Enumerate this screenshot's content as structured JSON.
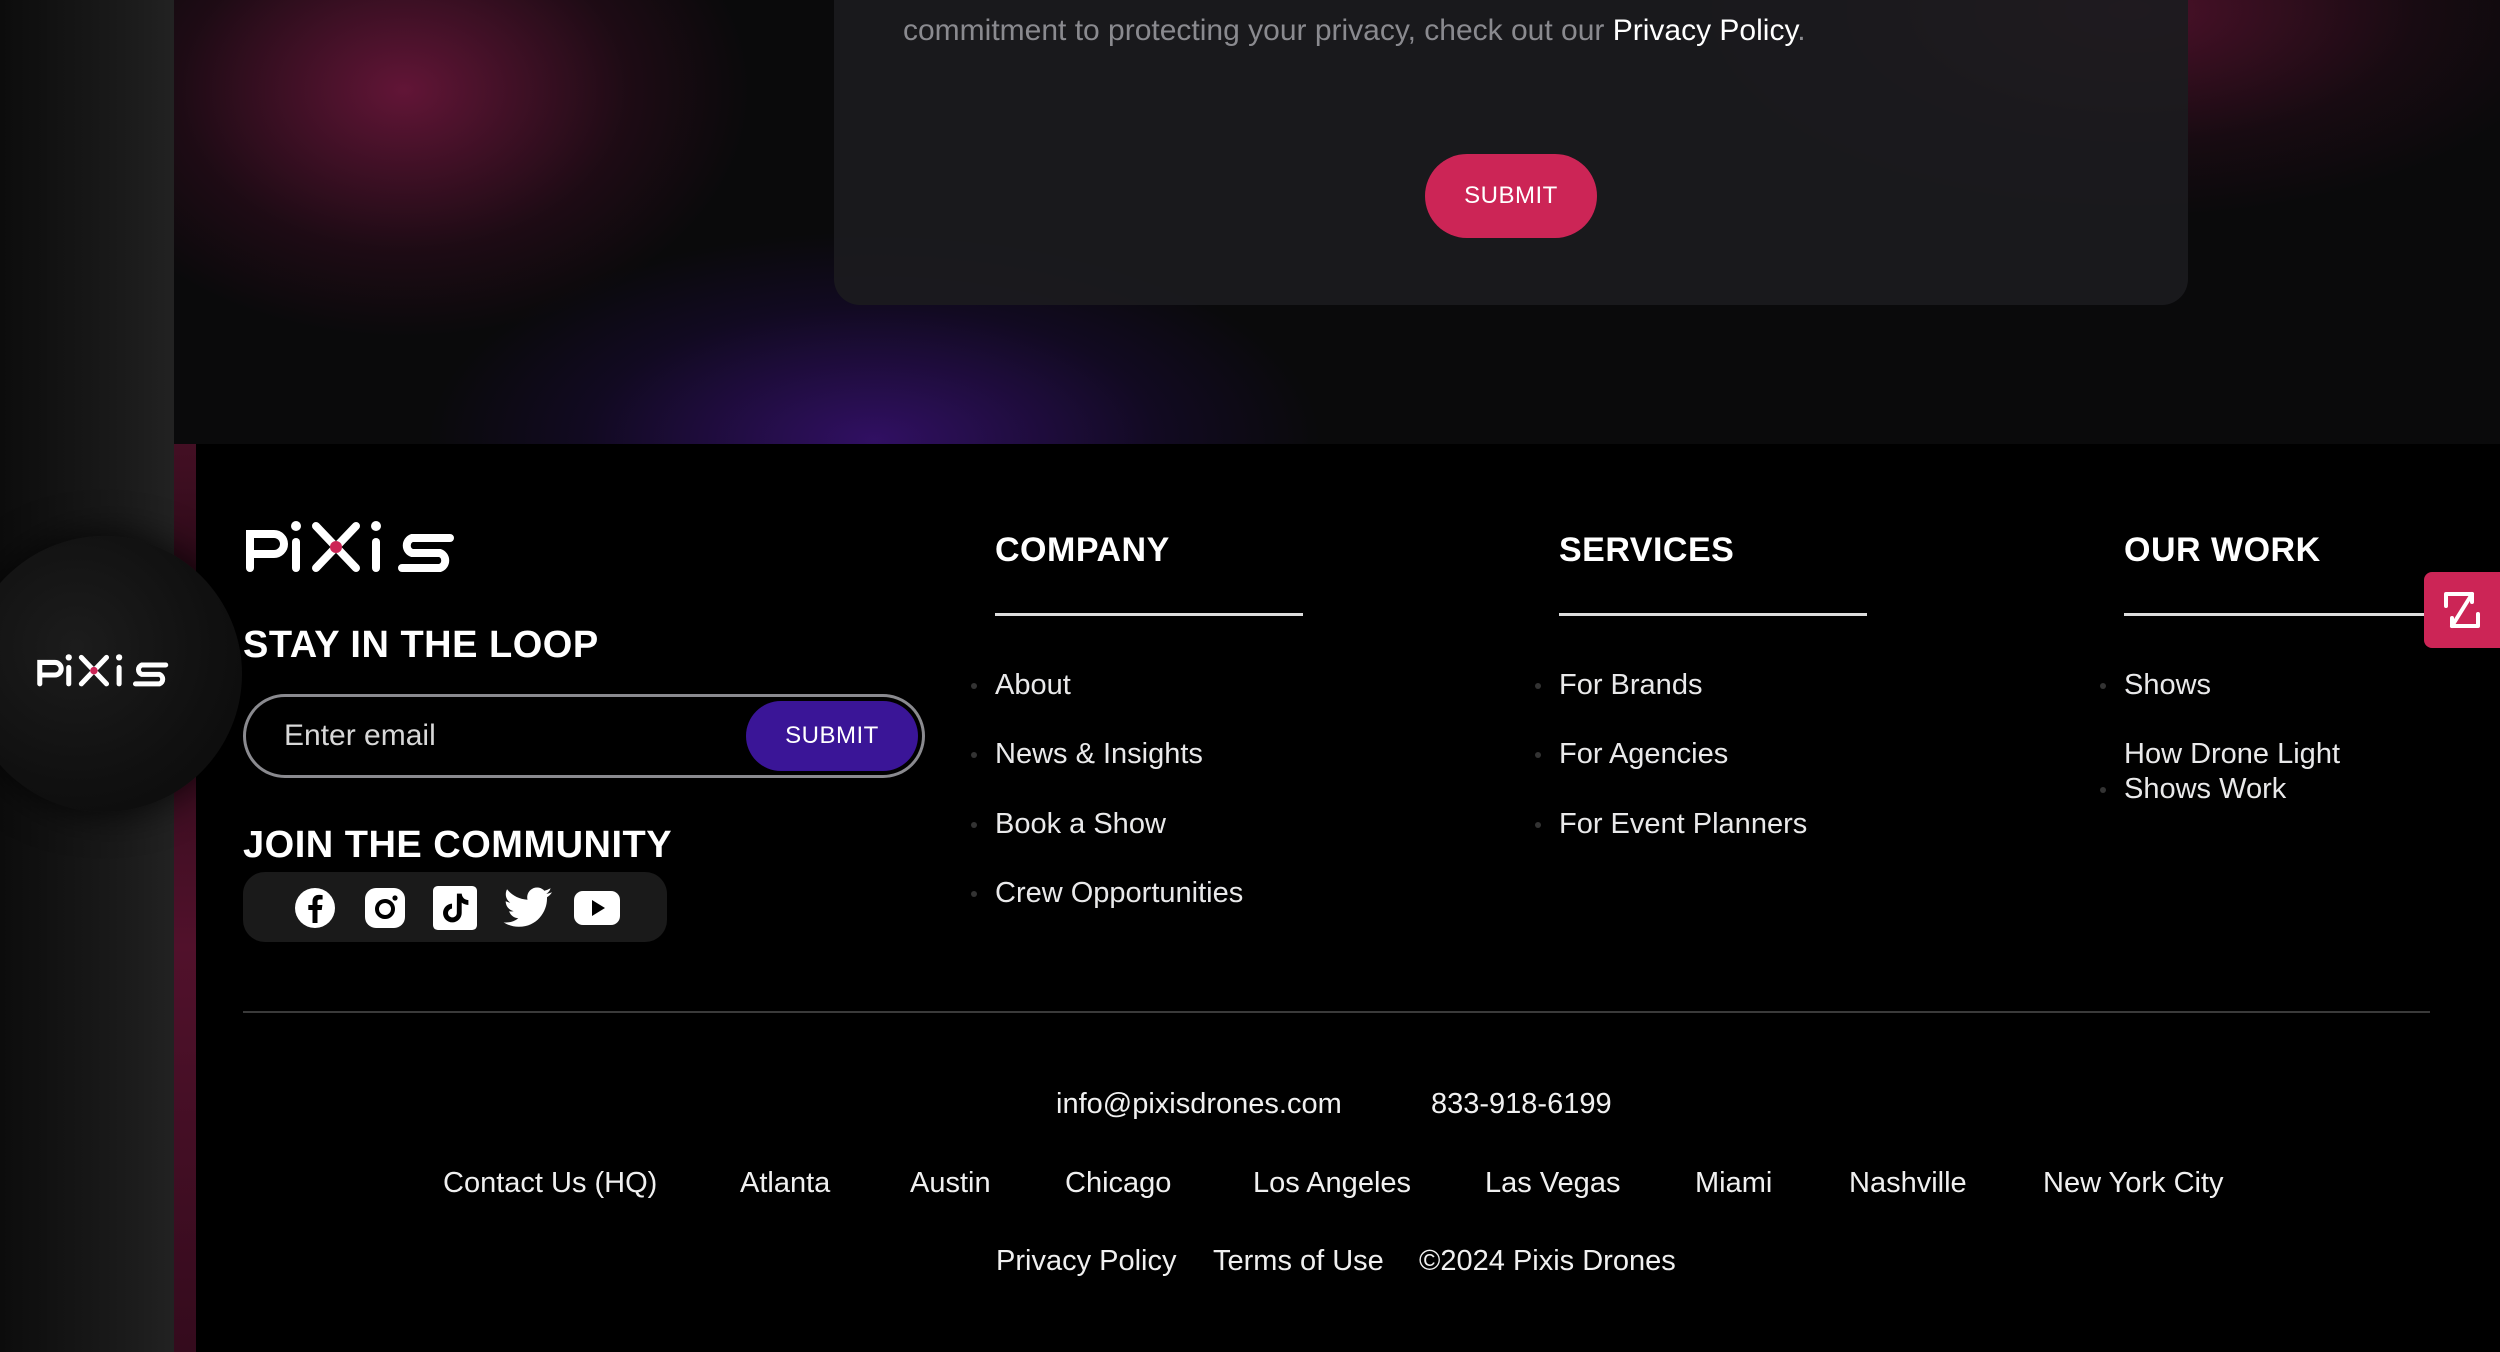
{
  "hero": {
    "consent_text": "commitment to protecting your privacy, check out our ",
    "privacy_link": "Privacy Policy",
    "consent_end": ".",
    "submit_label": "SUBMIT"
  },
  "brand": {
    "logo_text": "PiXiS"
  },
  "newsletter": {
    "heading": "STAY IN THE LOOP",
    "placeholder": "Enter email",
    "submit_label": "SUBMIT"
  },
  "community": {
    "heading": "JOIN THE COMMUNITY",
    "icons": [
      "facebook-icon",
      "instagram-icon",
      "tiktok-icon",
      "twitter-icon",
      "youtube-icon"
    ]
  },
  "columns": {
    "company": {
      "title": "COMPANY",
      "links": [
        "About",
        "News & Insights",
        "Book a Show",
        "Crew Opportunities"
      ]
    },
    "services": {
      "title": "SERVICES",
      "links": [
        "For Brands",
        "For Agencies",
        "For Event Planners"
      ]
    },
    "work": {
      "title": "OUR WORK",
      "links": [
        "Shows",
        "How Drone Light",
        "Shows Work"
      ]
    }
  },
  "contact": {
    "email": "info@pixisdrones.com",
    "phone": "833-918-6199"
  },
  "locations": [
    "Contact Us (HQ)",
    "Atlanta",
    "Austin",
    "Chicago",
    "Los Angeles",
    "Las Vegas",
    "Miami",
    "Nashville",
    "New York City"
  ],
  "legal": {
    "privacy": "Privacy Policy",
    "terms": "Terms of Use",
    "copyright": "©2024 Pixis Drones"
  },
  "colors": {
    "accent": "#cc2556",
    "submit_purple": "#3a1597"
  },
  "float_button": {
    "icon": "expand-arrow-icon"
  }
}
